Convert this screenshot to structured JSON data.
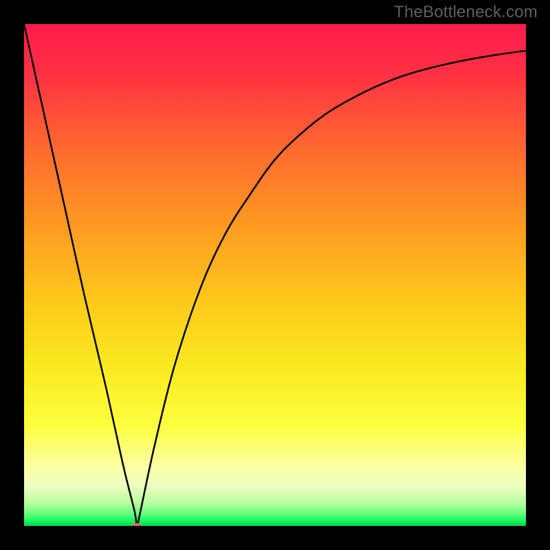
{
  "watermark": "TheBottleneck.com",
  "gradient": {
    "stops": [
      {
        "pos": 0.0,
        "color": "#ff1b4b"
      },
      {
        "pos": 0.1,
        "color": "#ff3143"
      },
      {
        "pos": 0.25,
        "color": "#ff6a2f"
      },
      {
        "pos": 0.4,
        "color": "#ff9a21"
      },
      {
        "pos": 0.55,
        "color": "#ffc81a"
      },
      {
        "pos": 0.68,
        "color": "#f9e91e"
      },
      {
        "pos": 0.8,
        "color": "#fdff3e"
      },
      {
        "pos": 0.88,
        "color": "#fcffa0"
      },
      {
        "pos": 0.92,
        "color": "#ecffbf"
      },
      {
        "pos": 0.955,
        "color": "#b7ff9f"
      },
      {
        "pos": 0.975,
        "color": "#67ff7e"
      },
      {
        "pos": 0.99,
        "color": "#19f55f"
      },
      {
        "pos": 1.0,
        "color": "#00d74c"
      }
    ]
  },
  "chart_data": {
    "type": "line",
    "title": "",
    "xlabel": "",
    "ylabel": "",
    "xlim": [
      0,
      100
    ],
    "ylim": [
      0,
      100
    ],
    "grid": false,
    "legend": false,
    "series": [
      {
        "name": "curve",
        "x": [
          0,
          4,
          8,
          12,
          16,
          18,
          20,
          22,
          22.5,
          23,
          26,
          30,
          35,
          40,
          45,
          50,
          55,
          60,
          65,
          70,
          75,
          80,
          85,
          90,
          95,
          100
        ],
        "values": [
          100,
          82,
          64,
          46,
          29,
          20,
          11,
          3,
          0,
          2,
          16,
          32,
          47,
          58,
          66,
          73,
          78,
          82,
          85,
          87.5,
          89.5,
          91,
          92.2,
          93.2,
          94,
          94.7
        ]
      }
    ],
    "marker": {
      "x": 22.5,
      "y": 0,
      "color": "#d46f6b",
      "rx": 7,
      "ry": 4.5
    }
  }
}
